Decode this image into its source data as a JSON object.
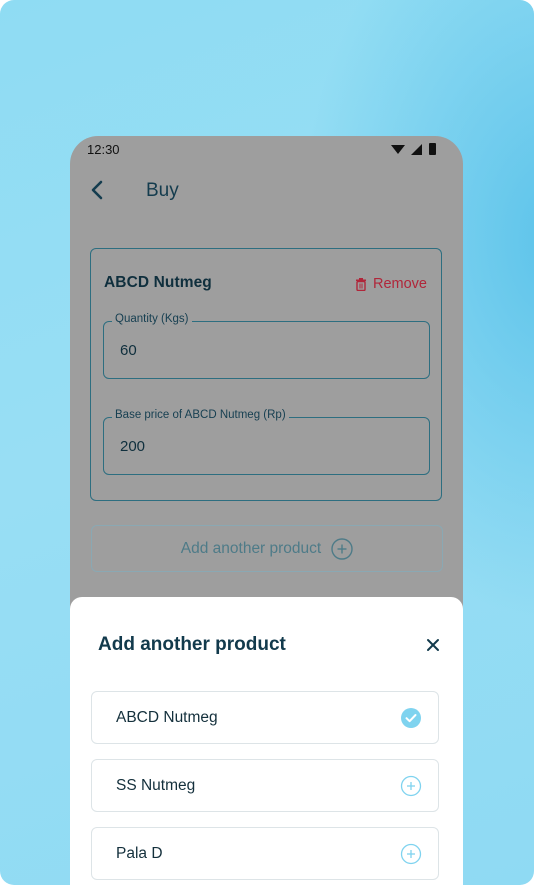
{
  "status_bar": {
    "time": "12:30"
  },
  "app_bar": {
    "title": "Buy"
  },
  "product_card": {
    "name": "ABCD Nutmeg",
    "remove_label": "Remove",
    "quantity_label": "Quantity (Kgs)",
    "quantity_value": "60",
    "price_label": "Base price of ABCD Nutmeg (Rp)",
    "price_value": "200"
  },
  "add_button": {
    "label": "Add another product"
  },
  "sheet": {
    "title": "Add another product",
    "options": [
      {
        "label": "ABCD Nutmeg",
        "state": "selected"
      },
      {
        "label": "SS Nutmeg",
        "state": "add"
      },
      {
        "label": "Pala D",
        "state": "add"
      }
    ]
  },
  "colors": {
    "accent": "#123a4c",
    "remove": "#b0263a",
    "selected_check": "#7fd3ef",
    "add_icon": "#7fd3ef"
  }
}
